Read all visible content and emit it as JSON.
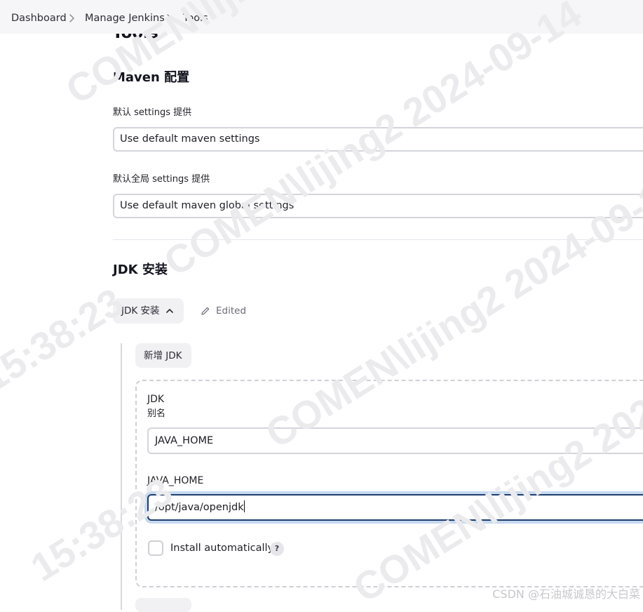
{
  "breadcrumb": {
    "items": [
      "Dashboard",
      "Manage Jenkins",
      "Tools"
    ]
  },
  "page": {
    "title": "Tools"
  },
  "maven": {
    "section_title": "Maven 配置",
    "settings_label": "默认 settings 提供",
    "settings_value": "Use default maven settings",
    "global_settings_label": "默认全局 settings 提供",
    "global_settings_value": "Use default maven global settings"
  },
  "jdk": {
    "section_title": "JDK 安装",
    "collapse_button_label": "JDK 安装",
    "edited_label": "Edited",
    "add_button_label": "新增 JDK",
    "item": {
      "title": "JDK",
      "alias_label": "别名",
      "alias_value": "JAVA_HOME",
      "java_home_label": "JAVA_HOME",
      "java_home_value": "/opt/java/openjdk",
      "install_auto_label": "Install automatically",
      "install_auto_checked": false,
      "help_label": "?"
    }
  },
  "watermark": {
    "lines": [
      "COMEN\\lijing2 2024-09-14",
      "15:38:23"
    ],
    "corner_text": "CSDN @石油城诚恳的大白菜"
  },
  "icons": {
    "breadcrumb_separator": "chevron-right-icon",
    "collapse": "chevron-up-icon",
    "edited": "pencil-icon",
    "help": "question-icon"
  }
}
